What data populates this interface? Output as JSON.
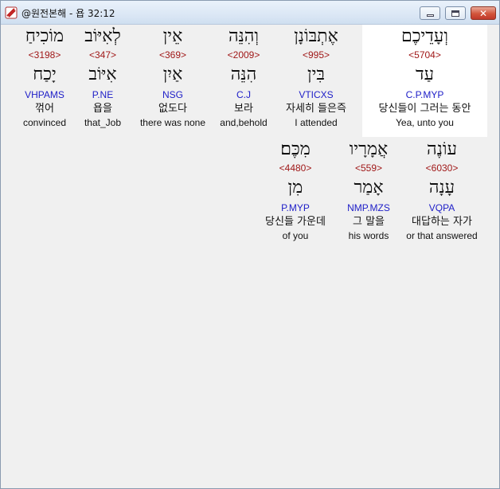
{
  "window": {
    "title": "@원전본해 - 욥 32:12",
    "buttons": {
      "minimize": "minimize-icon",
      "maximize": "maximize-icon",
      "close": "close-icon"
    }
  },
  "colors": {
    "strong": "#a01818",
    "morph": "#2020c8",
    "highlight": "#ffffff"
  },
  "words": [
    {
      "heb": "וְעָדֵיכֶם",
      "strong": "<5704>",
      "root": "עַד",
      "morph": "C.P.MYP",
      "korean": "당신들이 그러는 동안",
      "english": "Yea, unto you",
      "highlighted": true
    },
    {
      "heb": "אֶתְבּוֹנָן",
      "strong": "<995>",
      "root": "בִּין",
      "morph": "VTICXS",
      "korean": "자세히 들은즉",
      "english": "I attended",
      "highlighted": false
    },
    {
      "heb": "וְהִנֵּה",
      "strong": "<2009>",
      "root": "הִנֵּה",
      "morph": "C.J",
      "korean": "보라",
      "english": "and,behold",
      "highlighted": false
    },
    {
      "heb": "אֵין",
      "strong": "<369>",
      "root": "אַיִן",
      "morph": "NSG",
      "korean": "없도다",
      "english": "there was none",
      "highlighted": false
    },
    {
      "heb": "לְאִיּוֹב",
      "strong": "<347>",
      "root": "אִיּוֹב",
      "morph": "P.NE",
      "korean": "욥을",
      "english": "that_Job",
      "highlighted": false
    },
    {
      "heb": "מוֹכִיחַ",
      "strong": "<3198>",
      "root": "יָכַח",
      "morph": "VHPAMS",
      "korean": "꺾어",
      "english": "convinced",
      "highlighted": false
    },
    {
      "heb": "עוֹנֶה",
      "strong": "<6030>",
      "root": "עָנָה",
      "morph": "VQPA",
      "korean": "대답하는 자가",
      "english": "or that answered",
      "highlighted": false
    },
    {
      "heb": "אֲמָרָיו",
      "strong": "<559>",
      "root": "אָמַר",
      "morph": "NMP.MZS",
      "korean": "그 말을",
      "english": "his words",
      "highlighted": false
    },
    {
      "heb": "מִכֶּם׃",
      "strong": "<4480>",
      "root": "מִן",
      "morph": "P.MYP",
      "korean": "당신들 가운데",
      "english": "of you",
      "highlighted": false
    }
  ]
}
